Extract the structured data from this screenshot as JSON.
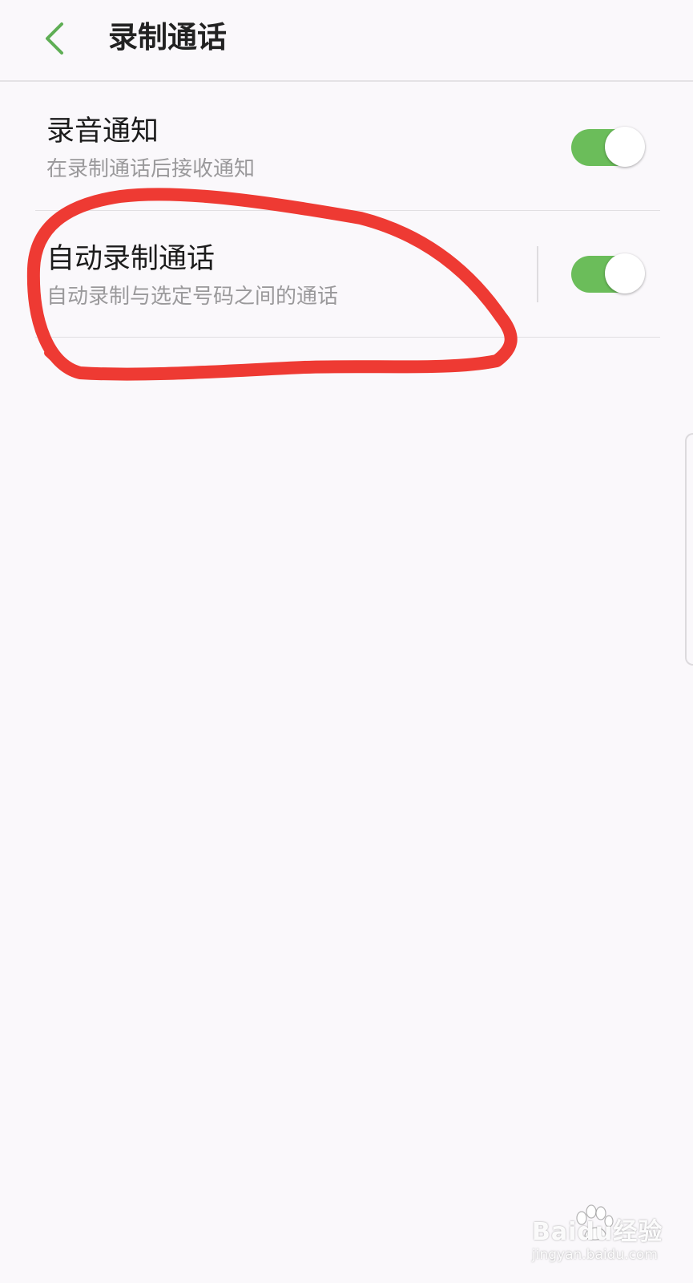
{
  "header": {
    "back_icon": "chevron-left-icon",
    "title": "录制通话"
  },
  "settings": [
    {
      "title": "录音通知",
      "subtitle": "在录制通话后接收通知",
      "toggle_on": true
    },
    {
      "title": "自动录制通话",
      "subtitle": "自动录制与选定号码之间的通话",
      "toggle_on": true
    }
  ],
  "watermark": {
    "brand": "Baidu经验",
    "url": "jingyan.baidu.com"
  },
  "colors": {
    "accent": "#6bbd5a",
    "annotation": "#ee3a33",
    "background": "#faf8fb"
  }
}
